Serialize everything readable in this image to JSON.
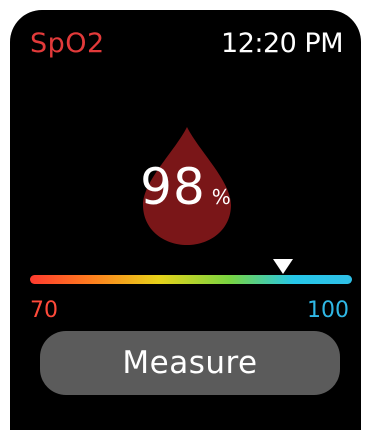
{
  "header": {
    "title": "SpO2",
    "time": "12:20 PM"
  },
  "reading": {
    "value": "98",
    "unit": "%",
    "level": 98
  },
  "scale": {
    "min": "70",
    "max": "100",
    "min_color": "#ff4a3a",
    "max_color": "#2fb8e6"
  },
  "action": {
    "measure_label": "Measure"
  },
  "colors": {
    "title": "#e23a3a",
    "drop": "#7a1618",
    "button": "#5b5b5b"
  },
  "icons": {
    "drop": "blood-drop-icon",
    "marker": "triangle-pointer-icon"
  }
}
